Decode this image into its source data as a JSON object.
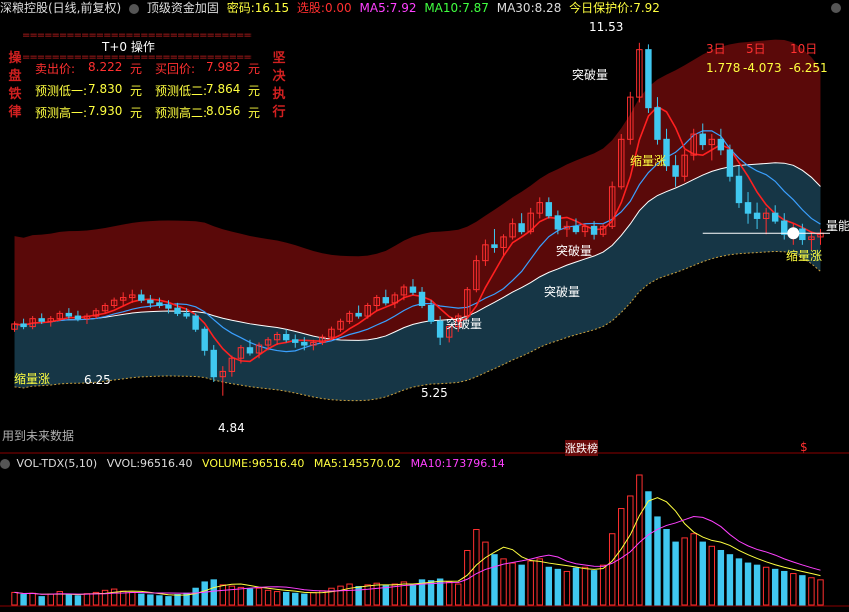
{
  "header": {
    "stock": "深粮控股(日线,前复权)",
    "indicator": "顶级资金加固",
    "password_label": "密码:",
    "password_value": "16.15",
    "select_label": "选股:",
    "select_value": "0.00",
    "ma5_label": "MA5:",
    "ma5_value": "7.92",
    "ma10_label": "MA10:",
    "ma10_value": "7.87",
    "ma30_label": "MA30:",
    "ma30_value": "8.28",
    "protect_label": "今日保护价:",
    "protect_value": "7.92"
  },
  "ops_panel": {
    "title": "T+0 操作",
    "left_vertical": [
      "操",
      "盘",
      "铁",
      "律"
    ],
    "right_vertical": [
      "坚",
      "决",
      "执",
      "行"
    ],
    "rows": [
      {
        "l_label": "卖出价:",
        "l_value": "8.222",
        "l_unit": "元",
        "r_label": "买回价:",
        "r_value": "7.982",
        "r_unit": "元"
      },
      {
        "l_label": "预测低一:",
        "l_value": "7.830",
        "l_unit": "元",
        "r_label": "预测低二:",
        "r_value": "7.864",
        "r_unit": "元"
      },
      {
        "l_label": "预测高一:",
        "l_value": "7.930",
        "l_unit": "元",
        "r_label": "预测高二:",
        "r_value": "8.056",
        "r_unit": "元"
      }
    ],
    "separator": "================================"
  },
  "returns": {
    "headers": [
      "3日",
      "5日",
      "10日"
    ],
    "values": [
      "1.778",
      "-4.073",
      "-6.251"
    ]
  },
  "annotations": {
    "high_price": "11.53",
    "low_price": "4.84",
    "low_price2": "5.25",
    "left_price": "6.25",
    "future_data": "用到未来数据",
    "break_volume": "突破量",
    "shrink_rise": "缩量涨",
    "volume_label": "量能",
    "bottom_label": "涨跌榜",
    "dollar": "$"
  },
  "volume_header": {
    "name": "VOL-TDX(5,10)",
    "vvol_label": "VVOL:",
    "vvol_value": "96516.40",
    "volume_label": "VOLUME:",
    "volume_value": "96516.40",
    "ma5_label": "MA5:",
    "ma5_value": "145570.02",
    "ma10_label": "MA10:",
    "ma10_value": "173796.14"
  },
  "colors": {
    "up": "#ff3030",
    "down": "#40c8f0",
    "ma5": "#ffffff",
    "ma10": "#ffff00",
    "ma30": "#ff40ff",
    "band_red": "#6a0a0a",
    "band_blue": "#17394a",
    "label_yellow": "#ffff40",
    "label_magenta": "#ff40ff",
    "label_green": "#40ff40"
  },
  "chart_data": {
    "type": "candlestick",
    "price_range": [
      4.0,
      12.0
    ],
    "candles": [
      [
        6.1,
        6.25,
        6.05,
        6.2
      ],
      [
        6.2,
        6.3,
        6.1,
        6.15
      ],
      [
        6.15,
        6.35,
        6.1,
        6.3
      ],
      [
        6.3,
        6.4,
        6.2,
        6.25
      ],
      [
        6.25,
        6.35,
        6.15,
        6.3
      ],
      [
        6.3,
        6.45,
        6.25,
        6.4
      ],
      [
        6.4,
        6.5,
        6.3,
        6.35
      ],
      [
        6.35,
        6.45,
        6.25,
        6.3
      ],
      [
        6.3,
        6.4,
        6.2,
        6.35
      ],
      [
        6.35,
        6.5,
        6.3,
        6.45
      ],
      [
        6.45,
        6.6,
        6.4,
        6.55
      ],
      [
        6.55,
        6.7,
        6.5,
        6.65
      ],
      [
        6.65,
        6.8,
        6.55,
        6.7
      ],
      [
        6.7,
        6.85,
        6.6,
        6.75
      ],
      [
        6.75,
        6.85,
        6.6,
        6.65
      ],
      [
        6.65,
        6.75,
        6.5,
        6.6
      ],
      [
        6.6,
        6.7,
        6.5,
        6.55
      ],
      [
        6.55,
        6.65,
        6.4,
        6.5
      ],
      [
        6.5,
        6.6,
        6.35,
        6.4
      ],
      [
        6.4,
        6.5,
        6.3,
        6.35
      ],
      [
        6.35,
        6.4,
        6.05,
        6.1
      ],
      [
        6.1,
        6.15,
        5.6,
        5.7
      ],
      [
        5.7,
        5.8,
        5.1,
        5.2
      ],
      [
        5.2,
        5.4,
        4.84,
        5.3
      ],
      [
        5.3,
        5.6,
        5.2,
        5.55
      ],
      [
        5.55,
        5.8,
        5.45,
        5.75
      ],
      [
        5.75,
        5.9,
        5.6,
        5.65
      ],
      [
        5.65,
        5.85,
        5.55,
        5.8
      ],
      [
        5.8,
        5.95,
        5.7,
        5.9
      ],
      [
        5.9,
        6.05,
        5.8,
        6.0
      ],
      [
        6.0,
        6.1,
        5.85,
        5.9
      ],
      [
        5.9,
        6.0,
        5.75,
        5.85
      ],
      [
        5.85,
        5.95,
        5.7,
        5.8
      ],
      [
        5.8,
        5.9,
        5.7,
        5.85
      ],
      [
        5.85,
        6.0,
        5.8,
        5.95
      ],
      [
        5.95,
        6.15,
        5.9,
        6.1
      ],
      [
        6.1,
        6.3,
        6.05,
        6.25
      ],
      [
        6.25,
        6.45,
        6.2,
        6.4
      ],
      [
        6.4,
        6.55,
        6.3,
        6.35
      ],
      [
        6.35,
        6.6,
        6.3,
        6.55
      ],
      [
        6.55,
        6.75,
        6.45,
        6.7
      ],
      [
        6.7,
        6.85,
        6.55,
        6.6
      ],
      [
        6.6,
        6.8,
        6.5,
        6.75
      ],
      [
        6.75,
        6.95,
        6.65,
        6.9
      ],
      [
        6.9,
        7.05,
        6.75,
        6.8
      ],
      [
        6.8,
        6.9,
        6.5,
        6.55
      ],
      [
        6.55,
        6.65,
        6.2,
        6.25
      ],
      [
        6.25,
        6.35,
        5.8,
        5.95
      ],
      [
        5.95,
        6.2,
        5.85,
        6.15
      ],
      [
        6.15,
        6.4,
        6.05,
        6.35
      ],
      [
        6.35,
        6.9,
        6.3,
        6.85
      ],
      [
        6.85,
        7.5,
        6.8,
        7.4
      ],
      [
        7.4,
        7.8,
        7.3,
        7.7
      ],
      [
        7.7,
        8.0,
        7.55,
        7.65
      ],
      [
        7.65,
        7.9,
        7.5,
        7.85
      ],
      [
        7.85,
        8.2,
        7.8,
        8.1
      ],
      [
        8.1,
        8.3,
        7.9,
        7.95
      ],
      [
        7.95,
        8.4,
        7.9,
        8.3
      ],
      [
        8.3,
        8.6,
        8.2,
        8.5
      ],
      [
        8.5,
        8.6,
        8.2,
        8.25
      ],
      [
        8.25,
        8.35,
        7.9,
        8.0
      ],
      [
        8.0,
        8.15,
        7.85,
        8.05
      ],
      [
        8.05,
        8.2,
        7.9,
        7.95
      ],
      [
        7.95,
        8.1,
        7.85,
        8.05
      ],
      [
        8.05,
        8.15,
        7.8,
        7.9
      ],
      [
        7.9,
        8.1,
        7.85,
        8.05
      ],
      [
        8.05,
        8.9,
        8.0,
        8.8
      ],
      [
        8.8,
        9.8,
        8.75,
        9.7
      ],
      [
        9.7,
        10.6,
        9.6,
        10.5
      ],
      [
        10.5,
        11.53,
        10.4,
        11.4
      ],
      [
        11.4,
        11.5,
        10.2,
        10.3
      ],
      [
        10.3,
        10.5,
        9.6,
        9.7
      ],
      [
        9.7,
        9.9,
        9.1,
        9.2
      ],
      [
        9.2,
        9.4,
        8.8,
        9.0
      ],
      [
        9.0,
        9.5,
        8.9,
        9.4
      ],
      [
        9.4,
        9.9,
        9.3,
        9.8
      ],
      [
        9.8,
        10.0,
        9.5,
        9.6
      ],
      [
        9.6,
        9.8,
        9.3,
        9.7
      ],
      [
        9.7,
        9.9,
        9.4,
        9.5
      ],
      [
        9.5,
        9.6,
        8.9,
        9.0
      ],
      [
        9.0,
        9.2,
        8.4,
        8.5
      ],
      [
        8.5,
        8.7,
        8.1,
        8.3
      ],
      [
        8.3,
        8.5,
        8.0,
        8.2
      ],
      [
        8.2,
        8.4,
        7.9,
        8.3
      ],
      [
        8.3,
        8.45,
        8.1,
        8.15
      ],
      [
        8.15,
        8.3,
        7.8,
        7.9
      ],
      [
        7.9,
        8.1,
        7.7,
        8.0
      ],
      [
        8.0,
        8.1,
        7.7,
        7.8
      ],
      [
        7.8,
        7.95,
        7.6,
        7.85
      ],
      [
        7.85,
        8.0,
        7.7,
        7.92
      ]
    ],
    "volume": [
      30,
      25,
      28,
      20,
      26,
      32,
      24,
      22,
      27,
      30,
      35,
      38,
      33,
      30,
      26,
      24,
      22,
      20,
      25,
      28,
      40,
      55,
      60,
      48,
      45,
      42,
      38,
      40,
      35,
      32,
      30,
      28,
      26,
      30,
      34,
      40,
      45,
      50,
      44,
      48,
      52,
      46,
      50,
      55,
      48,
      60,
      58,
      62,
      55,
      50,
      130,
      180,
      150,
      120,
      110,
      100,
      95,
      105,
      110,
      90,
      85,
      80,
      88,
      90,
      82,
      95,
      170,
      230,
      260,
      310,
      270,
      210,
      180,
      150,
      160,
      170,
      150,
      140,
      130,
      120,
      110,
      100,
      95,
      90,
      85,
      80,
      75,
      70,
      65,
      60
    ],
    "ma5_line": "white",
    "ma10_line": "yellow"
  }
}
